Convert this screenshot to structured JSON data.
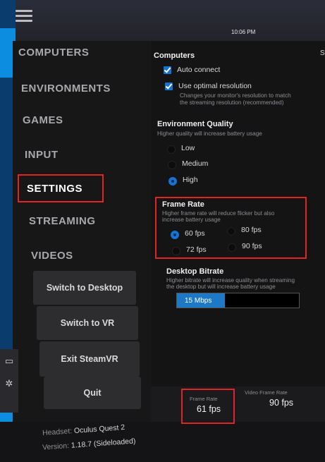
{
  "header": {
    "time": "10:06 PM"
  },
  "nav": {
    "items": [
      {
        "label": "COMPUTERS"
      },
      {
        "label": "ENVIRONMENTS"
      },
      {
        "label": "GAMES"
      },
      {
        "label": "INPUT"
      },
      {
        "label": "SETTINGS",
        "active": true
      },
      {
        "label": "STREAMING"
      },
      {
        "label": "VIDEOS"
      }
    ],
    "buttons": {
      "switch_desktop": "Switch to Desktop",
      "switch_vr": "Switch to VR",
      "exit_steamvr": "Exit SteamVR",
      "quit": "Quit"
    }
  },
  "footer": {
    "headset_label": "Headset:",
    "headset_value": "Oculus Quest 2",
    "version_label": "Version:",
    "version_value": "1.18.7 (Sideloaded)"
  },
  "settings": {
    "computers": {
      "title": "Computers",
      "auto_connect": "Auto connect",
      "optimal_resolution": "Use optimal resolution",
      "optimal_desc_1": "Changes your monitor's resolution to match",
      "optimal_desc_2": "the streaming resolution (recommended)"
    },
    "environment_quality": {
      "title": "Environment Quality",
      "desc": "Higher quality will increase battery usage",
      "options": [
        "Low",
        "Medium",
        "High"
      ],
      "selected": "High"
    },
    "frame_rate": {
      "title": "Frame Rate",
      "desc_1": "Higher frame rate will reduce flicker but also",
      "desc_2": "increase battery usage",
      "options": [
        "60 fps",
        "80 fps",
        "72 fps",
        "90 fps"
      ],
      "selected": "60 fps"
    },
    "desktop_bitrate": {
      "title": "Desktop Bitrate",
      "desc_1": "Higher bitrate will increase quality when streaming",
      "desc_2": "the desktop but will increase battery usage",
      "value": "15 Mbps"
    }
  },
  "stats": {
    "frame_rate_label": "Frame Rate",
    "frame_rate_value": "61 fps",
    "video_frame_rate_label": "Video Frame Rate",
    "video_frame_rate_value": "90 fps"
  },
  "colors": {
    "accent": "#1673d4",
    "highlight_box": "#e0242a"
  }
}
